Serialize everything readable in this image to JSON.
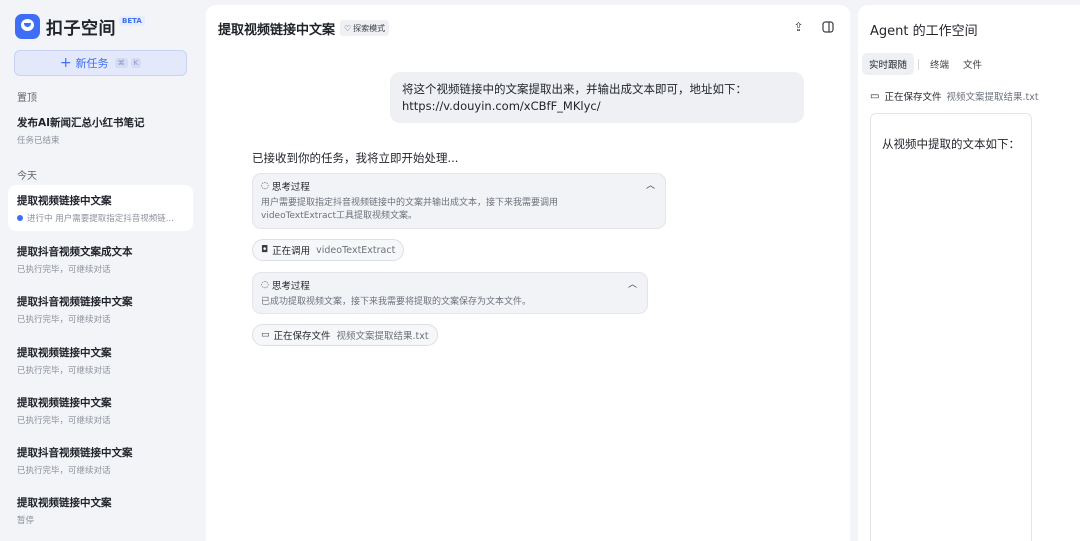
{
  "app": {
    "name": "扣子空间",
    "badge": "BETA"
  },
  "sidebar": {
    "new_task_label": "新任务",
    "shortcut_keys": [
      "⌘",
      "K"
    ],
    "pinned_label": "置顶",
    "pinned": [
      {
        "title": "发布AI新闻汇总小红书笔记",
        "status": "任务已结束"
      }
    ],
    "today_label": "今天",
    "tasks": [
      {
        "title": "提取视频链接中文案",
        "status": "进行中 用户需要提取指定抖音视频链..."
      },
      {
        "title": "提取抖音视频文案成文本",
        "status": "已执行完毕，可继续对话"
      },
      {
        "title": "提取抖音视频链接中文案",
        "status": "已执行完毕，可继续对话"
      },
      {
        "title": "提取视频链接中文案",
        "status": "已执行完毕，可继续对话"
      },
      {
        "title": "提取视频链接中文案",
        "status": "已执行完毕，可继续对话"
      },
      {
        "title": "提取抖音视频链接中文案",
        "status": "已执行完毕，可继续对话"
      },
      {
        "title": "提取视频链接中文案",
        "status": "暂停"
      }
    ]
  },
  "main": {
    "title": "提取视频链接中文案",
    "mode_tag": "探索模式",
    "user_message_line1": "将这个视频链接中的文案提取出来，并输出成文本即可，地址如下：",
    "user_message_line2": "https://v.douyin.com/xCBfF_MKlyc/",
    "ack": "已接收到你的任务，我将立即开始处理...",
    "think1": {
      "label": "思考过程",
      "line1": "用户需要提取指定抖音视频链接中的文案并输出成文本，接下来我需要调用",
      "line2": "videoTextExtract工具提取视频文案。"
    },
    "call_chip": {
      "label": "正在调用",
      "arg": "videoTextExtract"
    },
    "think2": {
      "label": "思考过程",
      "line1": "已成功提取视频文案，接下来我需要将提取的文案保存为文本文件。"
    },
    "save_chip": {
      "label": "正在保存文件",
      "arg": "视频文案提取结果.txt"
    }
  },
  "workspace": {
    "title": "Agent 的工作空间",
    "tabs": [
      "实时跟随",
      "终端",
      "文件"
    ],
    "file_status": "正在保存文件",
    "file_name": "视频文案提取结果.txt",
    "file_content": "从视频中提取的文本如下："
  },
  "colors": {
    "accent": "#3d6ef5",
    "bubble": "#eef0f3"
  }
}
